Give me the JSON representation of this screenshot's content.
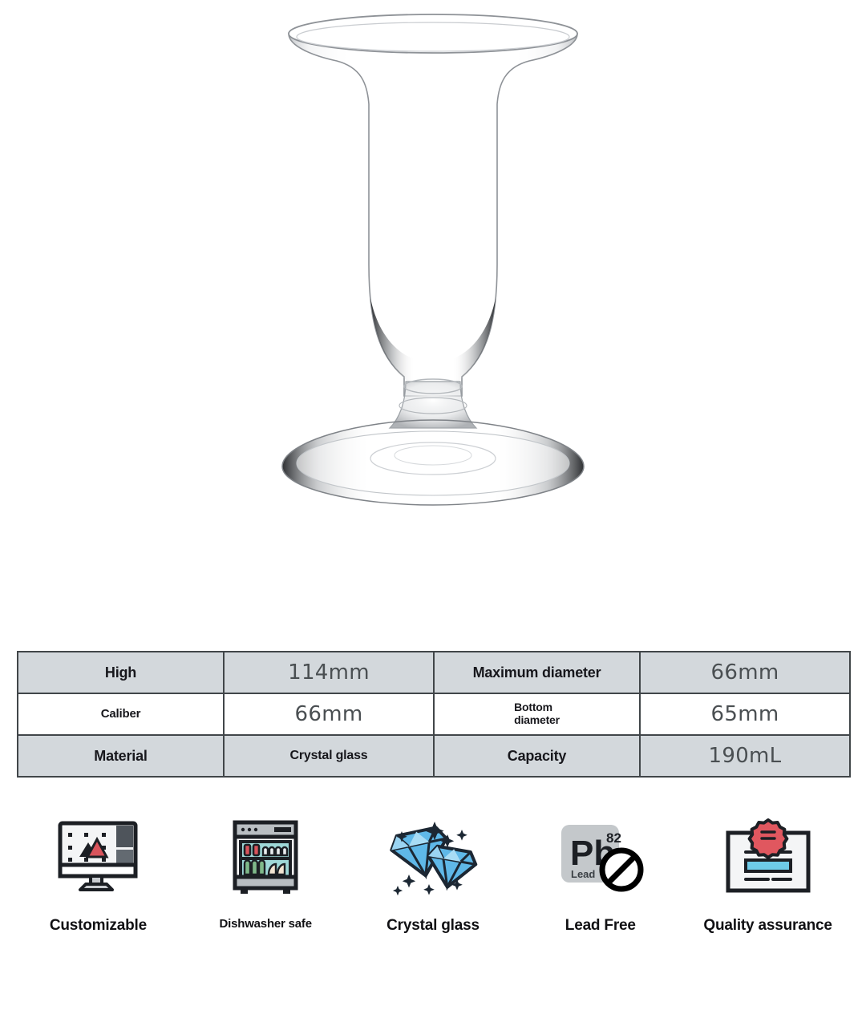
{
  "product": {
    "image_alt": "clear footed crystal whisky tumbler glass",
    "glass_type": "single-malt-whisky-glass"
  },
  "spec_table": {
    "rows": [
      {
        "shaded": true,
        "cells": [
          {
            "kind": "label",
            "text": "High",
            "size": "big"
          },
          {
            "kind": "value",
            "text": "114mm",
            "size": "num"
          },
          {
            "kind": "label",
            "text": "Maximum diameter",
            "size": "big"
          },
          {
            "kind": "value",
            "text": "66mm",
            "size": "num"
          }
        ]
      },
      {
        "shaded": false,
        "cells": [
          {
            "kind": "label",
            "text": "Caliber",
            "size": "small"
          },
          {
            "kind": "value",
            "text": "66mm",
            "size": "num"
          },
          {
            "kind": "label",
            "text": "Bottom diameter",
            "size": "two-line"
          },
          {
            "kind": "value",
            "text": "65mm",
            "size": "num"
          }
        ]
      },
      {
        "shaded": true,
        "cells": [
          {
            "kind": "label",
            "text": "Material",
            "size": "big"
          },
          {
            "kind": "value",
            "text": "Crystal glass",
            "size": "bold-small"
          },
          {
            "kind": "label",
            "text": "Capacity",
            "size": "big"
          },
          {
            "kind": "value",
            "text": "190mL",
            "size": "num"
          }
        ]
      }
    ],
    "labels": {
      "high": "High",
      "high_value": "114mm",
      "max_diameter": "Maximum diameter",
      "max_diameter_value": "66mm",
      "caliber": "Caliber",
      "caliber_value": "66mm",
      "bottom_diameter_line1": "Bottom",
      "bottom_diameter_line2": "diameter",
      "bottom_diameter_value": "65mm",
      "material": "Material",
      "material_value": "Crystal glass",
      "capacity": "Capacity",
      "capacity_value": "190mL"
    },
    "colors": {
      "border": "#414649",
      "shaded_row_bg": "#d3d8dc",
      "plain_row_bg": "#ffffff",
      "label_text": "#17171c",
      "value_text": "#4a4f52"
    }
  },
  "features": [
    {
      "icon": "monitor-design-icon",
      "label": "Customizable",
      "label_size": "lg"
    },
    {
      "icon": "dishwasher-icon",
      "label": "Dishwasher safe",
      "label_size": "sm"
    },
    {
      "icon": "diamonds-sparkle-icon",
      "label": "Crystal glass",
      "label_size": "lg"
    },
    {
      "icon": "lead-free-icon",
      "label": "Lead Free",
      "label_size": "lg"
    },
    {
      "icon": "certificate-icon",
      "label": "Quality assurance",
      "label_size": "lg"
    }
  ],
  "lead_free_icon_text": {
    "symbol": "Pb",
    "atomic_number": "82",
    "element_name": "Lead"
  },
  "palette": {
    "ink": "#1c1f24",
    "diamond_blue": "#5fb8e8",
    "diamond_blue_light": "#a8dcf5",
    "seal_red": "#e0575f",
    "ribbon_gold": "#f0cd7a",
    "cert_blue": "#6ecbe8",
    "lead_gray": "#c4c8cb",
    "dishwasher_gray": "#b9bec2",
    "dishwasher_teal": "#9fd8d8",
    "dishwasher_green": "#7fb98a",
    "accent_red": "#d9545c"
  }
}
